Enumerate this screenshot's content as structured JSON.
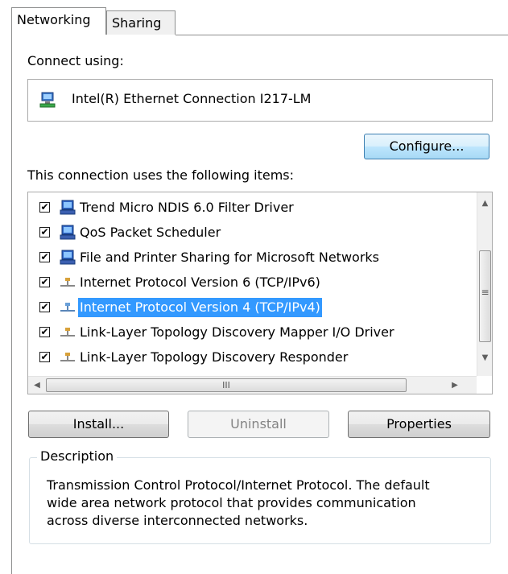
{
  "tabs": [
    {
      "label": "Networking",
      "active": true
    },
    {
      "label": "Sharing",
      "active": false
    }
  ],
  "connect_using": {
    "label": "Connect using:",
    "adapter": "Intel(R) Ethernet Connection I217-LM",
    "adapter_icon": "network-adapter-icon"
  },
  "configure_button": "Configure...",
  "items_label": "This connection uses the following items:",
  "items": [
    {
      "label": "Trend Micro NDIS 6.0 Filter Driver",
      "checked": true,
      "icon": "network-client-icon",
      "selected": false
    },
    {
      "label": "QoS Packet Scheduler",
      "checked": true,
      "icon": "network-client-icon",
      "selected": false
    },
    {
      "label": "File and Printer Sharing for Microsoft Networks",
      "checked": true,
      "icon": "network-client-icon",
      "selected": false
    },
    {
      "label": "Internet Protocol Version 6 (TCP/IPv6)",
      "checked": true,
      "icon": "protocol-icon",
      "selected": false
    },
    {
      "label": "Internet Protocol Version 4 (TCP/IPv4)",
      "checked": true,
      "icon": "protocol-icon",
      "selected": true
    },
    {
      "label": "Link-Layer Topology Discovery Mapper I/O Driver",
      "checked": true,
      "icon": "protocol-icon",
      "selected": false
    },
    {
      "label": "Link-Layer Topology Discovery Responder",
      "checked": true,
      "icon": "protocol-icon",
      "selected": false
    }
  ],
  "buttons": {
    "install": "Install...",
    "uninstall": "Uninstall",
    "properties": "Properties"
  },
  "description": {
    "legend": "Description",
    "text_lines": [
      "Transmission Control Protocol/Internet Protocol. The default",
      "wide area network protocol that provides communication",
      "across diverse interconnected networks."
    ]
  },
  "colors": {
    "selection": "#3399ff",
    "border": "#8e8f8f"
  },
  "check_glyph": "✔",
  "hscroll_grip": "III",
  "vscroll_grip": "≡"
}
